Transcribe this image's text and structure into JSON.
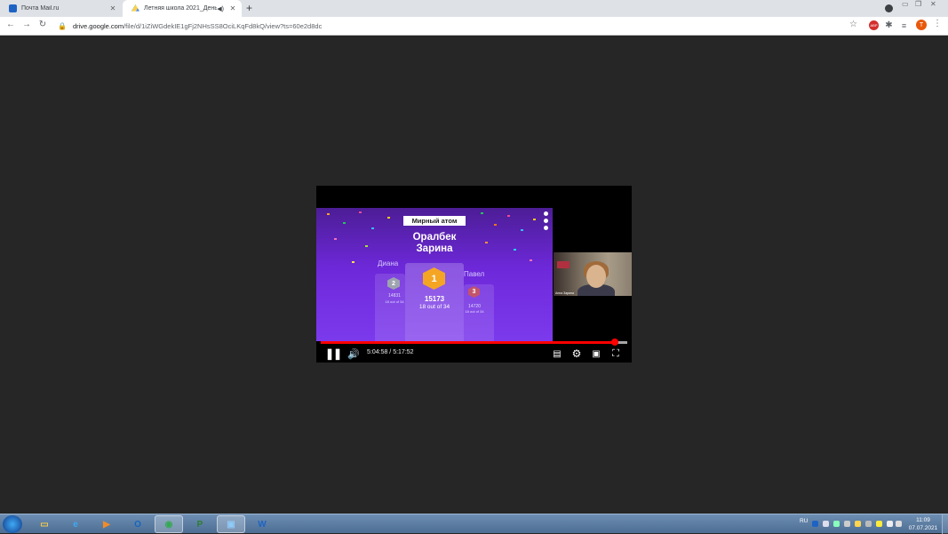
{
  "browser": {
    "tabs": [
      {
        "title": "Почта Mail.ru",
        "icon": "mail-icon",
        "active": false
      },
      {
        "title": "Летняя школа 2021_День 2",
        "icon": "google-drive-icon",
        "active": true
      }
    ],
    "new_tab_symbol": "+",
    "url_host": "drive.google.com",
    "url_path": "/file/d/1iZiWGdekIE1gFj2NHsSS8OciLKqFd8kQ/view?ts=60e2d8dc",
    "profile_initial": "T",
    "extension_abp": "ABP"
  },
  "slide": {
    "quiz_title": "Мирный атом",
    "winner_name_line1": "Оралбек",
    "winner_name_line2": "Зарина",
    "first": {
      "rank": "1",
      "score": "15173",
      "detail": "18 out of 34"
    },
    "second": {
      "name": "Диана",
      "rank": "2",
      "score": "14831",
      "detail": "18 out of 34"
    },
    "third": {
      "name": "Павел",
      "rank": "3",
      "score": "14720",
      "detail": "18 out of 34"
    }
  },
  "webcam": {
    "name_tag": "Анна Зарина"
  },
  "player": {
    "current_time": "5:04:58",
    "duration": "5:17:52",
    "time_separator": " / ",
    "progress_fraction": 0.959,
    "buffer_fraction": 1.0
  },
  "taskbar": {
    "apps": [
      {
        "name": "explorer-icon",
        "glyph": "▭",
        "color": "#f2c94c"
      },
      {
        "name": "internet-explorer-icon",
        "glyph": "e",
        "color": "#3fa9f5"
      },
      {
        "name": "media-player-icon",
        "glyph": "▶",
        "color": "#f28c28"
      },
      {
        "name": "outlook-icon",
        "glyph": "O",
        "color": "#1565c0"
      },
      {
        "name": "chrome-icon",
        "glyph": "◉",
        "color": "#34a853"
      },
      {
        "name": "project-icon",
        "glyph": "P",
        "color": "#2e7d32"
      },
      {
        "name": "remote-desktop-icon",
        "glyph": "▣",
        "color": "#90caf9"
      },
      {
        "name": "word-icon",
        "glyph": "W",
        "color": "#1e63c4"
      }
    ],
    "language": "RU",
    "time": "11:09",
    "date": "07.07.2021"
  },
  "colors": {
    "page_background": "#262626",
    "progress_red": "#ff0000",
    "slide_purple": "#6d28d9"
  }
}
